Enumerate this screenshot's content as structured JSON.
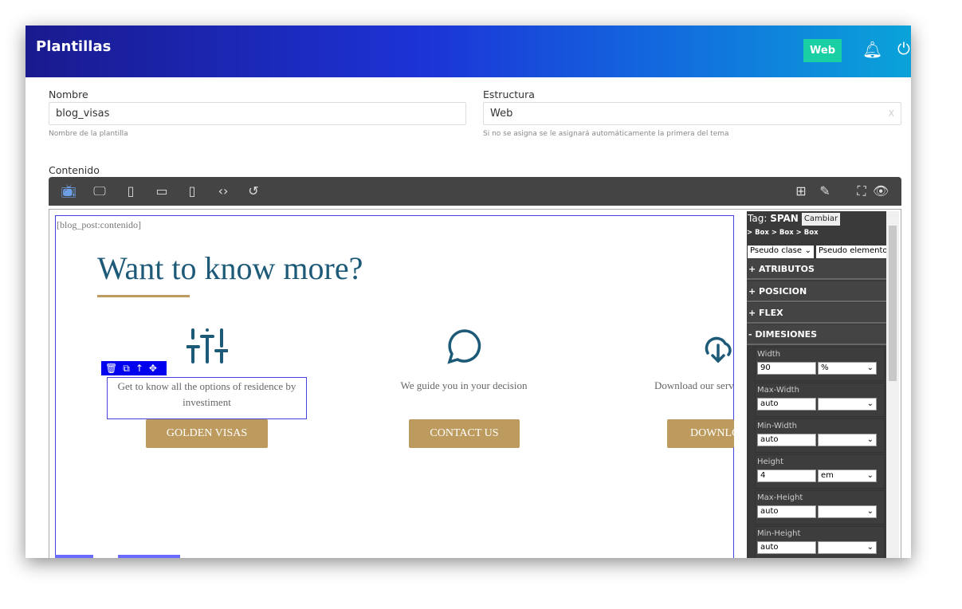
{
  "header": {
    "title": "Plantillas",
    "badge": "Web"
  },
  "form": {
    "nombre": {
      "label": "Nombre",
      "value": "blog_visas",
      "help": "Nombre de la plantilla"
    },
    "estructura": {
      "label": "Estructura",
      "value": "Web",
      "clear": "X",
      "help": "Si no se asigna se le asignará automáticamente la primera del tema"
    },
    "contenido_label": "Contenido"
  },
  "canvas": {
    "placeholder": "[blog_post:contenido]",
    "heading": "Want to know more?",
    "columns": [
      {
        "icon": "sliders-icon",
        "text": "Get to know all the options of residence by investiment",
        "button": "GOLDEN VISAS"
      },
      {
        "icon": "chat-bubble-icon",
        "text": "We guide you in your decision",
        "button": "CONTACT US"
      },
      {
        "icon": "cloud-download-icon",
        "text": "Download our serv",
        "button": "DOWNLO"
      }
    ],
    "colors": {
      "heading": "#1d5a78",
      "accent": "#bd9b5e",
      "selection": "#0000ff"
    }
  },
  "panel": {
    "tag_label": "Tag:",
    "tag": "SPAN",
    "change": "Cambiar",
    "breadcrumb": "> Box > Box > Box",
    "pseudo_class": "Pseudo clase",
    "pseudo_element": "Pseudo elemento",
    "sections": [
      "+ ATRIBUTOS",
      "+ POSICION",
      "+ FLEX",
      "- DIMESIONES"
    ],
    "fields": [
      {
        "label": "Width",
        "value": "90",
        "unit": "%"
      },
      {
        "label": "Max-Width",
        "value": "auto",
        "unit": ""
      },
      {
        "label": "Min-Width",
        "value": "auto",
        "unit": ""
      },
      {
        "label": "Height",
        "value": "4",
        "unit": "em"
      },
      {
        "label": "Max-Height",
        "value": "auto",
        "unit": ""
      },
      {
        "label": "Min-Height",
        "value": "auto",
        "unit": ""
      }
    ]
  }
}
